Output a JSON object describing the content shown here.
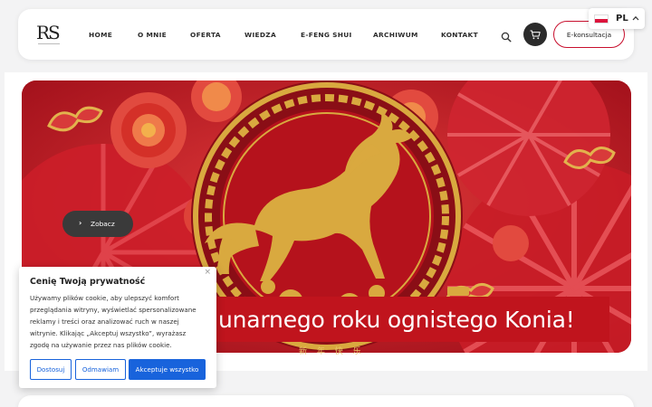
{
  "header": {
    "logo": "RS",
    "nav": [
      "HOME",
      "O MNIE",
      "OFERTA",
      "WIEDZA",
      "E-FENG SHUI",
      "ARCHIWUM",
      "KONTAKT"
    ],
    "cta_label": "E-konsultacja",
    "language": {
      "code": "PL",
      "flag_colors": [
        "#ffffff",
        "#dc143c"
      ]
    },
    "icons": {
      "search": "search-icon",
      "cart": "cart-icon",
      "lang_toggle": "chevron-up-icon"
    }
  },
  "hero": {
    "button_label": "Zobacz",
    "caption": "unarnego roku ognistego Konia!",
    "chinese_text": "新 年 快 乐",
    "colors": {
      "background": "#c01522",
      "gold": "#d9a93f",
      "dark_red": "#8a0e16"
    }
  },
  "cookie": {
    "title": "Cenię Twoją prywatność",
    "lines": [
      "Używamy plików cookie, aby ulepszyć komfort",
      "przeglądania witryny, wyświetlać spersonalizowane",
      "reklamy i treści oraz analizować ruch w naszej",
      "witrynie. Klikając „Akceptuj wszystko”, wyrażasz",
      "zgodę na używanie przez nas plików cookie."
    ],
    "close_label": "×",
    "buttons": {
      "customize": "Dostosuj",
      "reject": "Odmawiam",
      "accept": "Akceptuje wszystko"
    },
    "accent": "#1863dc"
  }
}
